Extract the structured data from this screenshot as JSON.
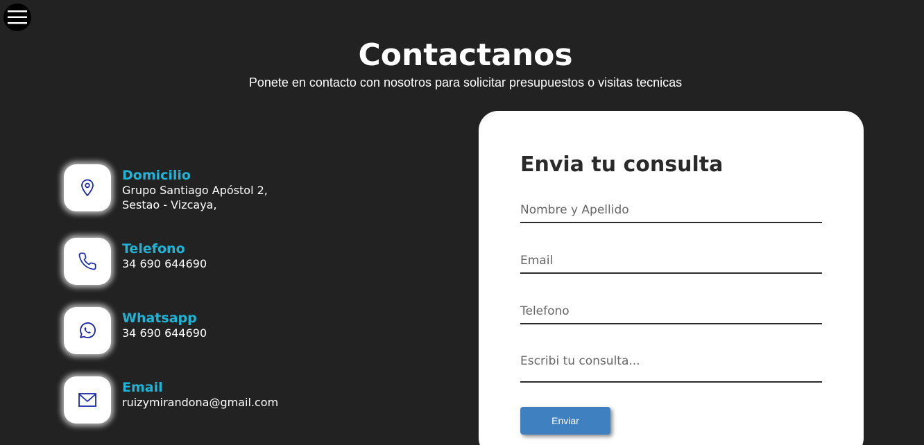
{
  "header": {
    "title": "Contactanos",
    "subtitle": "Ponete en contacto con nosotros para solicitar presupuestos o visitas tecnicas"
  },
  "contact": {
    "items": [
      {
        "icon": "map-pin-icon",
        "title": "Domicilio",
        "lines": [
          "Grupo Santiago Apóstol 2,",
          "Sestao - Vizcaya,"
        ]
      },
      {
        "icon": "phone-icon",
        "title": "Telefono",
        "lines": [
          "34 690 644690"
        ]
      },
      {
        "icon": "whatsapp-icon",
        "title": "Whatsapp",
        "lines": [
          "34 690 644690"
        ]
      },
      {
        "icon": "mail-icon",
        "title": "Email",
        "lines": [
          "ruizymirandona@gmail.com"
        ]
      }
    ]
  },
  "form": {
    "title": "Envia tu consulta",
    "name_placeholder": "Nombre y Apellido",
    "email_placeholder": "Email",
    "phone_placeholder": "Telefono",
    "message_placeholder": "Escribi tu consulta...",
    "name_value": "",
    "email_value": "",
    "phone_value": "",
    "message_value": "",
    "submit_label": "Enviar"
  },
  "colors": {
    "background": "#222222",
    "accent": "#1fb3d6",
    "icon_stroke": "#1a2aa8",
    "button": "#3f80c0",
    "card": "#ffffff"
  }
}
